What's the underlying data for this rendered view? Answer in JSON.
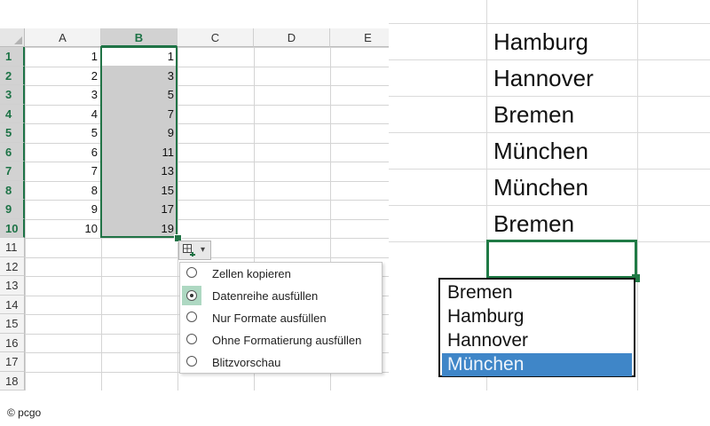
{
  "left_sheet": {
    "columns": [
      "A",
      "B",
      "C",
      "D",
      "E"
    ],
    "selected_column": "B",
    "rows": [
      "1",
      "2",
      "3",
      "4",
      "5",
      "6",
      "7",
      "8",
      "9",
      "10",
      "11",
      "12",
      "13",
      "14",
      "15",
      "16",
      "17",
      "18"
    ],
    "col_a_values": [
      "1",
      "2",
      "3",
      "4",
      "5",
      "6",
      "7",
      "8",
      "9",
      "10"
    ],
    "col_b_values": [
      "1",
      "3",
      "5",
      "7",
      "9",
      "11",
      "13",
      "15",
      "17",
      "19"
    ],
    "autofill_button": {
      "icon": "autofill-options-icon",
      "arrow": "▾"
    },
    "autofill_menu": [
      {
        "label": "Zellen kopieren",
        "selected": false
      },
      {
        "label": "Datenreihe ausfüllen",
        "selected": true
      },
      {
        "label": "Nur Formate ausfüllen",
        "selected": false
      },
      {
        "label": "Ohne Formatierung ausfüllen",
        "selected": false
      },
      {
        "label": "Blitzvorschau",
        "selected": false
      }
    ]
  },
  "right_sheet": {
    "cells": [
      "Hamburg",
      "Hannover",
      "Bremen",
      "München",
      "München",
      "Bremen"
    ],
    "dropdown_options": [
      "Bremen",
      "Hamburg",
      "Hannover",
      "München"
    ],
    "dropdown_selected": "München"
  },
  "watermark": "© pcgo",
  "colors": {
    "excel_green": "#217346",
    "selection_fill": "#cdcdcd",
    "dropdown_highlight": "#3f86c8"
  }
}
